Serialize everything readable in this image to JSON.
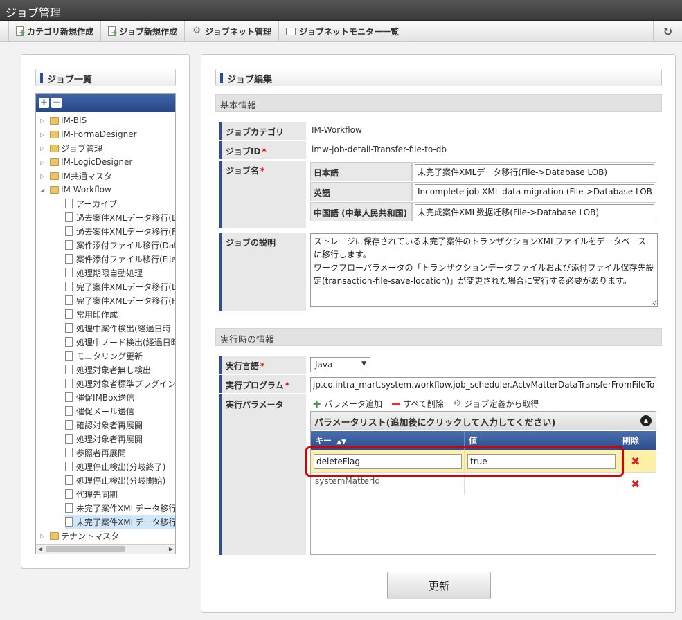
{
  "window": {
    "title": "ジョブ管理"
  },
  "toolbar": {
    "items": [
      {
        "label": "カテゴリ新規作成",
        "icon": "document-add-icon"
      },
      {
        "label": "ジョブ新規作成",
        "icon": "document-add-icon"
      },
      {
        "label": "ジョブネット管理",
        "icon": "gear-icon"
      },
      {
        "label": "ジョブネットモニター一覧",
        "icon": "monitor-icon"
      }
    ],
    "refresh_icon": "↻"
  },
  "left_panel": {
    "title": "ジョブ一覧",
    "expand_all": "+",
    "collapse_all": "−",
    "tree": [
      {
        "label": "IM-BIS",
        "type": "folder",
        "level": 0,
        "expanded": false
      },
      {
        "label": "IM-FormaDesigner",
        "type": "folder",
        "level": 0,
        "expanded": false
      },
      {
        "label": "ジョブ管理",
        "type": "folder",
        "level": 0,
        "expanded": false
      },
      {
        "label": "IM-LogicDesigner",
        "type": "folder",
        "level": 0,
        "expanded": false
      },
      {
        "label": "IM共通マスタ",
        "type": "folder",
        "level": 0,
        "expanded": false
      },
      {
        "label": "IM-Workflow",
        "type": "folder",
        "level": 0,
        "expanded": true
      },
      {
        "label": "アーカイブ",
        "type": "leaf",
        "level": 1
      },
      {
        "label": "過去案件XMLデータ移行(D",
        "type": "leaf",
        "level": 1
      },
      {
        "label": "過去案件XMLデータ移行(F",
        "type": "leaf",
        "level": 1
      },
      {
        "label": "案件添付ファイル移行(Data",
        "type": "leaf",
        "level": 1
      },
      {
        "label": "案件添付ファイル移行(File-",
        "type": "leaf",
        "level": 1
      },
      {
        "label": "処理期限自動処理",
        "type": "leaf",
        "level": 1
      },
      {
        "label": "完了案件XMLデータ移行(D",
        "type": "leaf",
        "level": 1
      },
      {
        "label": "完了案件XMLデータ移行(F",
        "type": "leaf",
        "level": 1
      },
      {
        "label": "常用印作成",
        "type": "leaf",
        "level": 1
      },
      {
        "label": "処理中案件検出(経過日時",
        "type": "leaf",
        "level": 1
      },
      {
        "label": "処理中ノード検出(経過日時",
        "type": "leaf",
        "level": 1
      },
      {
        "label": "モニタリング更新",
        "type": "leaf",
        "level": 1
      },
      {
        "label": "処理対象者無し検出",
        "type": "leaf",
        "level": 1
      },
      {
        "label": "処理対象者標準プラグイン(",
        "type": "leaf",
        "level": 1
      },
      {
        "label": "催促IMBox送信",
        "type": "leaf",
        "level": 1
      },
      {
        "label": "催促メール送信",
        "type": "leaf",
        "level": 1
      },
      {
        "label": "確認対象者再展開",
        "type": "leaf",
        "level": 1
      },
      {
        "label": "処理対象者再展開",
        "type": "leaf",
        "level": 1
      },
      {
        "label": "参照者再展開",
        "type": "leaf",
        "level": 1
      },
      {
        "label": "処理停止検出(分岐終了)",
        "type": "leaf",
        "level": 1
      },
      {
        "label": "処理停止検出(分岐開始)",
        "type": "leaf",
        "level": 1
      },
      {
        "label": "代理先同期",
        "type": "leaf",
        "level": 1
      },
      {
        "label": "未完了案件XMLデータ移行",
        "type": "leaf",
        "level": 1
      },
      {
        "label": "未完了案件XMLデータ移行",
        "type": "leaf",
        "level": 1,
        "selected": true
      },
      {
        "label": "テナントマスタ",
        "type": "folder",
        "level": 0,
        "expanded": false
      }
    ]
  },
  "editor": {
    "title": "ジョブ編集",
    "basic_section": "基本情報",
    "category_label": "ジョブカテゴリ",
    "category_value": "IM-Workflow",
    "id_label": "ジョブID",
    "id_value": "imw-job-detail-Transfer-file-to-db",
    "name_label": "ジョブ名",
    "names": [
      {
        "lang": "日本語",
        "value": "未完了案件XMLデータ移行(File->Database LOB)"
      },
      {
        "lang": "英語",
        "value": "Incomplete job XML data migration (File->Database LOB)"
      },
      {
        "lang": "中国語 (中華人民共和国)",
        "value": "未完成案件XML数据迁移(File->Database LOB)"
      }
    ],
    "desc_label": "ジョブの説明",
    "desc_value": "ストレージに保存されている未完了案件のトランザクションXMLファイルをデータベースに移行します。\nワークフローパラメータの「トランザクションデータファイルおよび添付ファイル保存先設定(transaction-file-save-location)」が変更された場合に実行する必要があります。",
    "runtime_section": "実行時の情報",
    "lang_label": "実行言語",
    "lang_value": "Java",
    "program_label": "実行プログラム",
    "program_value": "jp.co.intra_mart.system.workflow.job_scheduler.ActvMatterDataTransferFromFileToDB",
    "params_label": "実行パラメータ",
    "param_actions": {
      "add": "パラメータ追加",
      "remove_all": "すべて削除",
      "from_definition": "ジョブ定義から取得"
    },
    "param_table": {
      "title": "パラメータリスト(追加後にクリックして入力してください)",
      "col_key": "キー",
      "col_value": "値",
      "col_delete": "削除",
      "rows": [
        {
          "key": "deleteFlag",
          "value": "true"
        },
        {
          "key": "systemMatterId",
          "value": ""
        }
      ]
    },
    "update_button": "更新"
  }
}
